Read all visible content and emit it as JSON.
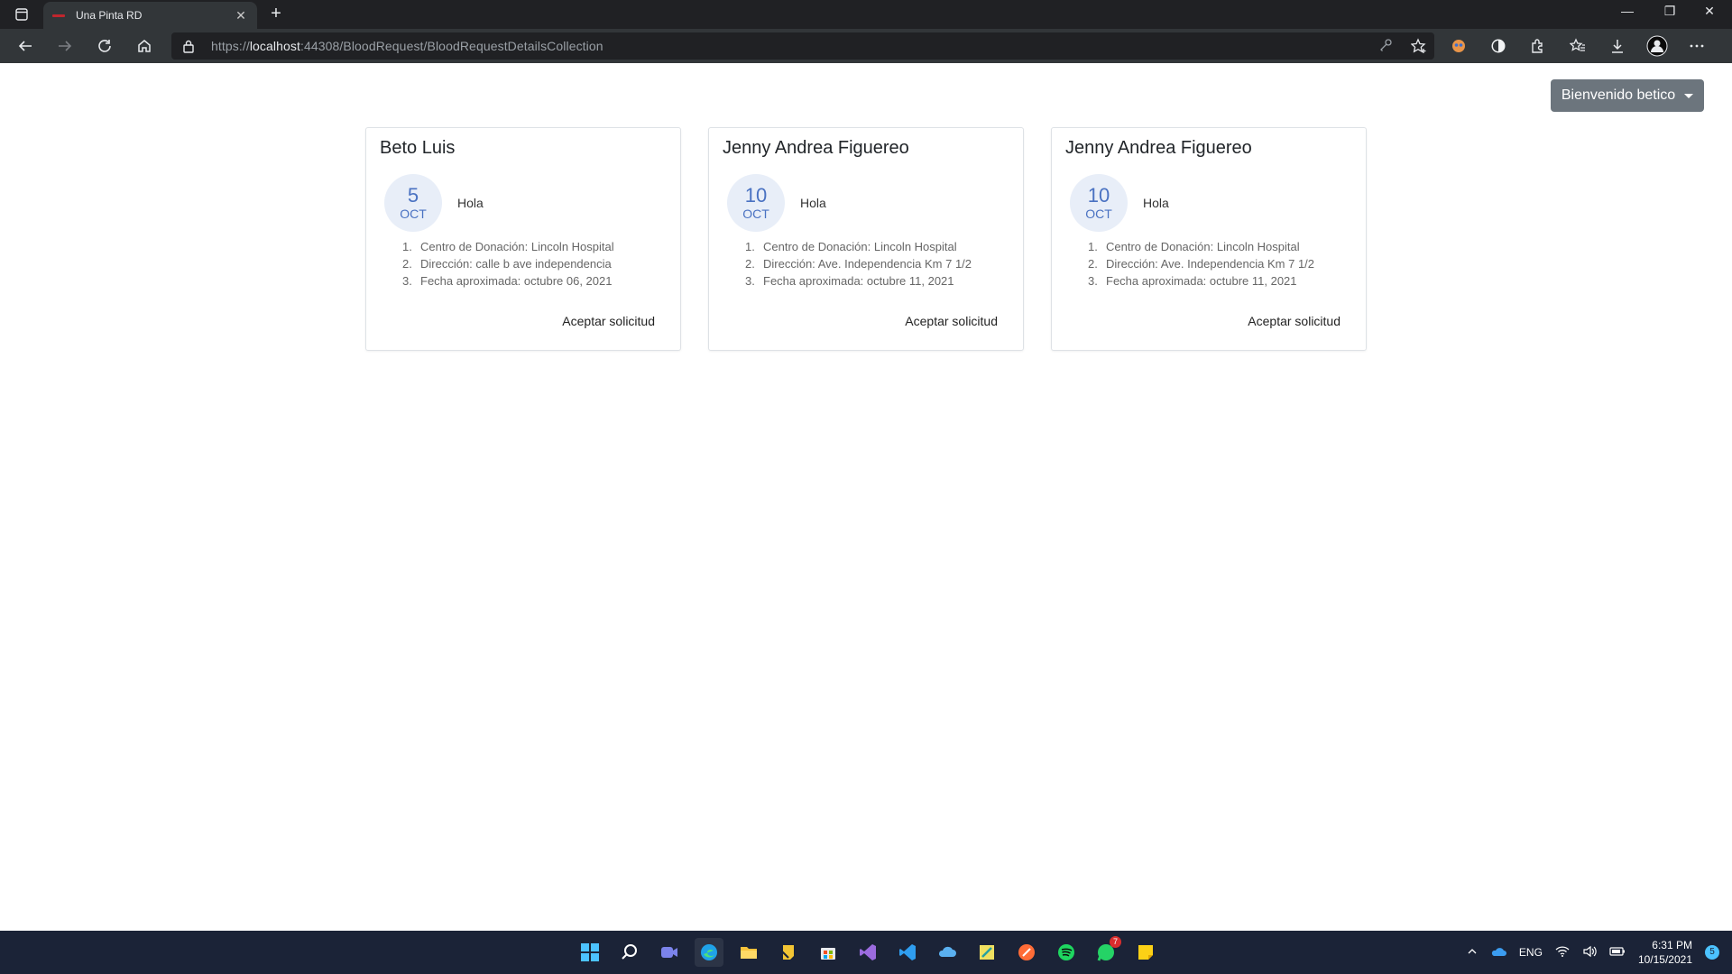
{
  "browser": {
    "tab_title": "Una Pinta RD",
    "url_scheme": "https://",
    "url_host": "localhost",
    "url_rest": ":44308/BloodRequest/BloodRequestDetailsCollection"
  },
  "header": {
    "welcome_label": "Bienvenido betico"
  },
  "cards": [
    {
      "name": "Beto Luis",
      "day": "5",
      "month": "OCT",
      "message": "Hola",
      "details": [
        {
          "num": "1.",
          "text": "Centro de Donación: Lincoln Hospital"
        },
        {
          "num": "2.",
          "text": "Dirección: calle b ave independencia"
        },
        {
          "num": "3.",
          "text": "Fecha aproximada: octubre 06, 2021"
        }
      ],
      "action": "Aceptar solicitud"
    },
    {
      "name": "Jenny Andrea Figuereo",
      "day": "10",
      "month": "OCT",
      "message": "Hola",
      "details": [
        {
          "num": "1.",
          "text": "Centro de Donación: Lincoln Hospital"
        },
        {
          "num": "2.",
          "text": "Dirección: Ave. Independencia Km 7 1/2"
        },
        {
          "num": "3.",
          "text": "Fecha aproximada: octubre 11, 2021"
        }
      ],
      "action": "Aceptar solicitud"
    },
    {
      "name": "Jenny Andrea Figuereo",
      "day": "10",
      "month": "OCT",
      "message": "Hola",
      "details": [
        {
          "num": "1.",
          "text": "Centro de Donación: Lincoln Hospital"
        },
        {
          "num": "2.",
          "text": "Dirección: Ave. Independencia Km 7 1/2"
        },
        {
          "num": "3.",
          "text": "Fecha aproximada: octubre 11, 2021"
        }
      ],
      "action": "Aceptar solicitud"
    }
  ],
  "taskbar": {
    "language": "ENG",
    "time": "6:31 PM",
    "date": "10/15/2021",
    "whatsapp_badge": "7",
    "notification_count": "5"
  },
  "colors": {
    "accent": "#4a72c2",
    "welcome_button": "#6c757d"
  }
}
